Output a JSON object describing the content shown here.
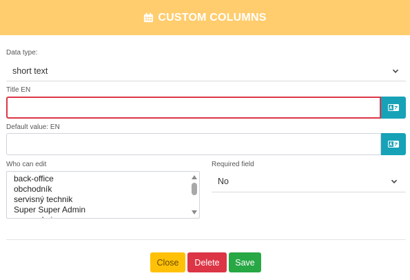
{
  "modal": {
    "title": "CUSTOM COLUMNS",
    "header_color": "#ffcd6e",
    "icon": "calendar-icon"
  },
  "form": {
    "data_type": {
      "label": "Data type:",
      "value": "short text"
    },
    "title_en": {
      "label": "Title EN",
      "value": "",
      "state": "invalid"
    },
    "default_value_en": {
      "label": "Default value: EN",
      "value": ""
    },
    "who_can_edit": {
      "label": "Who can edit",
      "options": [
        "back-office",
        "obchodník",
        "servisný technik",
        "Super Super Admin",
        "superadmin_en"
      ]
    },
    "required_field": {
      "label": "Required field",
      "value": "No"
    }
  },
  "buttons": {
    "close": "Close",
    "delete": "Delete",
    "save": "Save"
  },
  "colors": {
    "addon": "#17a2b8",
    "close": "#ffc107",
    "delete": "#dc3545",
    "save": "#28a745",
    "invalid_border": "#dc3545"
  }
}
